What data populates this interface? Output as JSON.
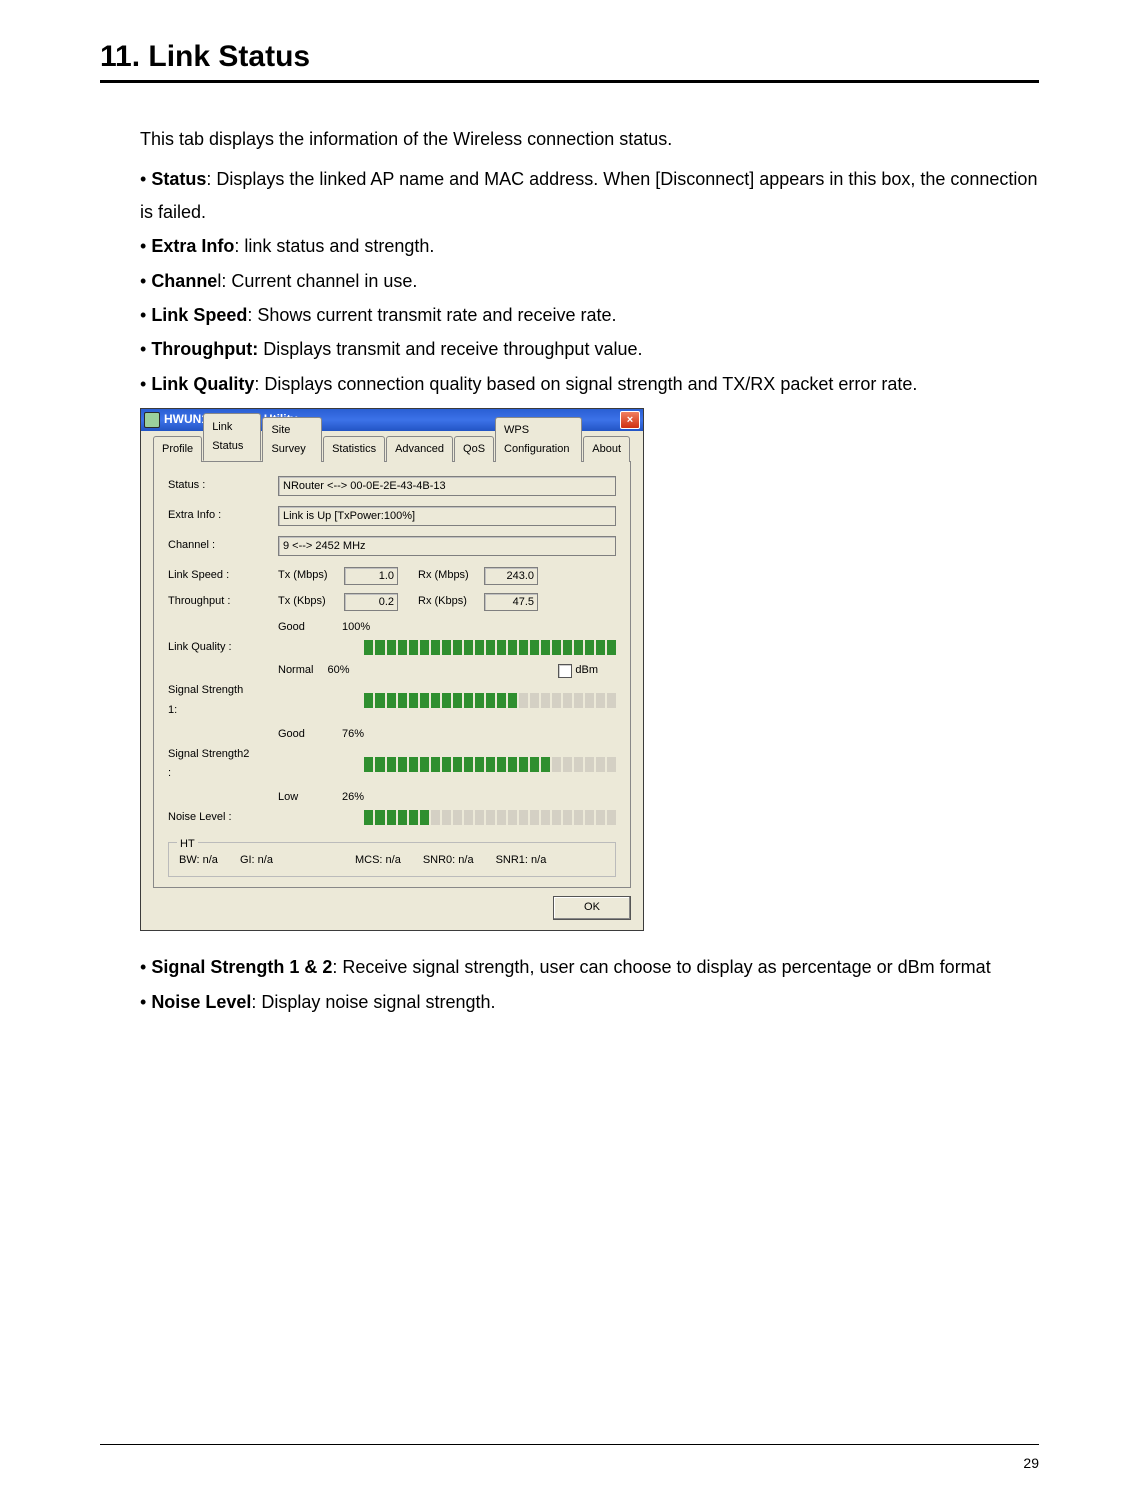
{
  "page_number": "29",
  "heading": "11.   Link Status",
  "intro_text": "This tab displays the information of the Wireless connection status.",
  "bullets_top": [
    {
      "label": "Status",
      "text": ": Displays the linked AP name and MAC address. When [Disconnect] appears in this box, the connection is failed."
    },
    {
      "label": "Extra Info",
      "text": ": link status and strength."
    },
    {
      "label": "Channe",
      "tail": "l: Current channel in use."
    },
    {
      "label": "Link Speed",
      "text": ": Shows current transmit rate and receive rate."
    },
    {
      "label": "Throughput:",
      "text": " Displays transmit and receive throughput value."
    },
    {
      "label": "Link Quality",
      "text": ": Displays connection quality based on signal strength and TX/RX packet error rate."
    }
  ],
  "bullets_bottom": [
    {
      "label": "Signal Strength 1 & 2",
      "text": ": Receive signal strength, user can choose to display as percentage or dBm format"
    },
    {
      "label": "Noise Level",
      "text": ": Display noise signal strength."
    }
  ],
  "window": {
    "title": "HWUN1 Wireless Utility",
    "tabs": [
      "Profile",
      "Link Status",
      "Site Survey",
      "Statistics",
      "Advanced",
      "QoS",
      "WPS Configuration",
      "About"
    ],
    "active_tab_index": 1,
    "fields": {
      "status_label": "Status :",
      "status_value": "NRouter <--> 00-0E-2E-43-4B-13",
      "extra_label": "Extra Info :",
      "extra_value": "Link is Up [TxPower:100%]",
      "channel_label": "Channel :",
      "channel_value": "9 <--> 2452 MHz"
    },
    "link_speed": {
      "label": "Link Speed :",
      "tx_label": "Tx (Mbps)",
      "tx_value": "1.0",
      "rx_label": "Rx (Mbps)",
      "rx_value": "243.0"
    },
    "throughput": {
      "label": "Throughput :",
      "tx_label": "Tx (Kbps)",
      "tx_value": "0.2",
      "rx_label": "Rx (Kbps)",
      "rx_value": "47.5"
    },
    "link_quality": {
      "label": "Link Quality :",
      "qual": "Good",
      "pct": "100%",
      "segments": 23,
      "on": 23
    },
    "sig1": {
      "label": "Signal Strength 1:",
      "qual": "Normal",
      "pct": "60%",
      "segments": 23,
      "on": 14,
      "dbm_label": "dBm"
    },
    "sig2": {
      "label": "Signal Strength2 :",
      "qual": "Good",
      "pct": "76%",
      "segments": 23,
      "on": 17
    },
    "noise": {
      "label": "Noise Level :",
      "qual": "Low",
      "pct": "26%",
      "segments": 23,
      "on": 6
    },
    "ht": {
      "legend": "HT",
      "bw": "BW: n/a",
      "gi": "GI: n/a",
      "mcs": "MCS: n/a",
      "snr0": "SNR0: n/a",
      "snr1": "SNR1: n/a"
    },
    "ok": "OK"
  }
}
